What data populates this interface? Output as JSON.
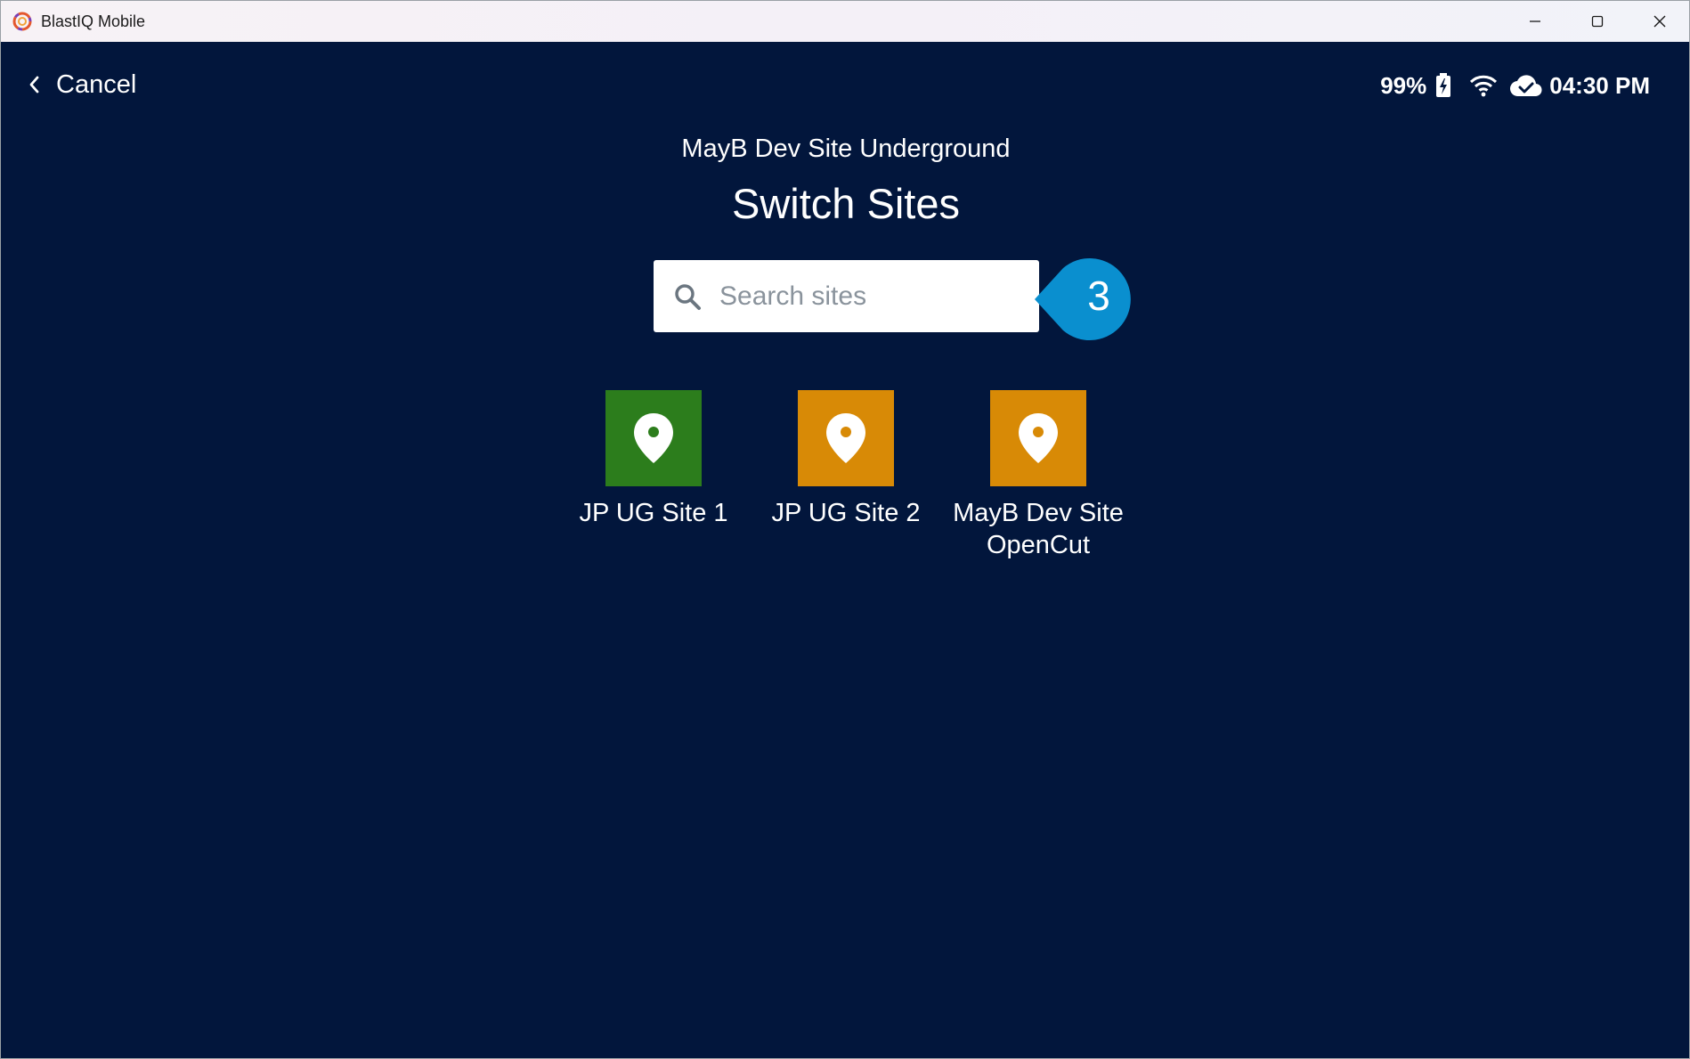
{
  "window": {
    "title": "BlastIQ Mobile",
    "controls": [
      "minimize-icon",
      "maximize-icon",
      "close-icon"
    ]
  },
  "header": {
    "back_icon": "chevron-left-icon",
    "cancel_label": "Cancel"
  },
  "status_bar": {
    "battery": "99%",
    "battery_icon": "battery-charging-icon",
    "wifi_icon": "wifi-icon",
    "cloud_icon": "cloud-done-icon",
    "time": "04:30 PM"
  },
  "main": {
    "current_site": "MayB Dev Site Underground",
    "title": "Switch Sites",
    "search": {
      "placeholder": "Search sites",
      "value": ""
    },
    "callout_number": "3",
    "sites": [
      {
        "name": "JP UG Site 1",
        "color": "#2c7d1c",
        "icon": "map-pin-icon"
      },
      {
        "name": "JP UG Site 2",
        "color": "#d88a06",
        "icon": "map-pin-icon"
      },
      {
        "name": "MayB Dev Site OpenCut",
        "color": "#d88a06",
        "icon": "map-pin-icon"
      }
    ]
  },
  "colors": {
    "background": "#02163c",
    "callout": "#0a8fcf"
  }
}
